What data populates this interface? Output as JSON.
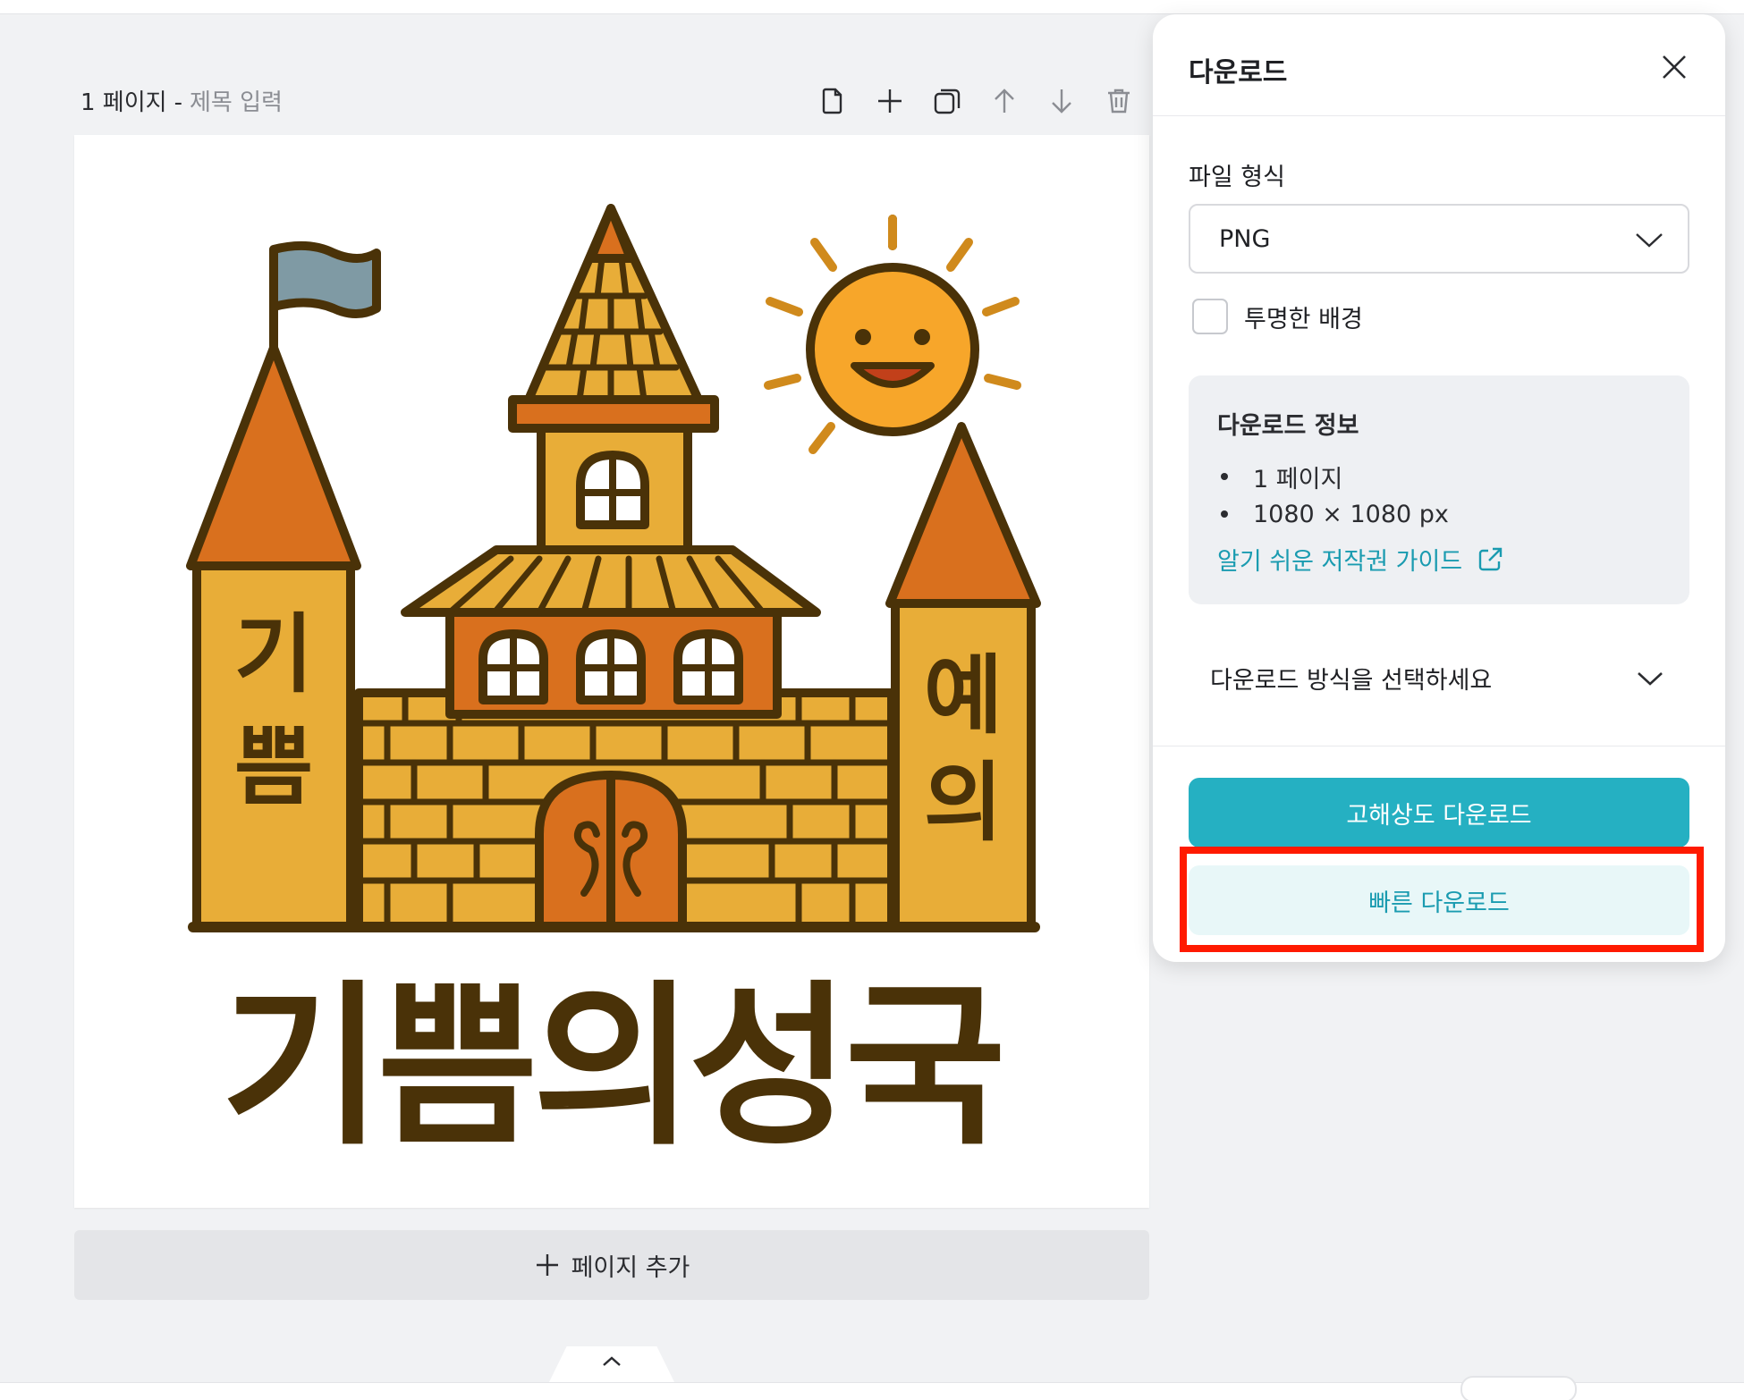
{
  "page_header": {
    "page_label": "1 페이지",
    "separator": "-",
    "title_placeholder": "제목 입력"
  },
  "page_tools": [
    {
      "name": "add-note-icon"
    },
    {
      "name": "plus-icon"
    },
    {
      "name": "duplicate-icon"
    },
    {
      "name": "arrow-up-icon"
    },
    {
      "name": "arrow-down-icon"
    },
    {
      "name": "trash-icon"
    }
  ],
  "canvas": {
    "headline": "기쁨의성국",
    "left_tower_text_1": "기",
    "left_tower_text_2": "쁨",
    "right_tower_text_1": "예",
    "right_tower_text_2": "의"
  },
  "add_page": {
    "label": "페이지 추가"
  },
  "download_panel": {
    "title": "다운로드",
    "file_format_label": "파일 형식",
    "file_format_value": "PNG",
    "transparent_bg_label": "투명한 배경",
    "info": {
      "title": "다운로드 정보",
      "pages": "1 페이지",
      "size": "1080 × 1080 px",
      "copyright_link": "알기 쉬운 저작권 가이드"
    },
    "method_label": "다운로드 방식을 선택하세요",
    "hires_button": "고해상도 다운로드",
    "quick_button": "빠른 다운로드"
  },
  "colors": {
    "accent": "#25b0c2",
    "accent_light": "#e8f7f8",
    "highlight": "#ff1a00",
    "castle_brown": "#4a3208",
    "castle_yellow": "#e8ad38",
    "castle_orange": "#d9701e"
  }
}
